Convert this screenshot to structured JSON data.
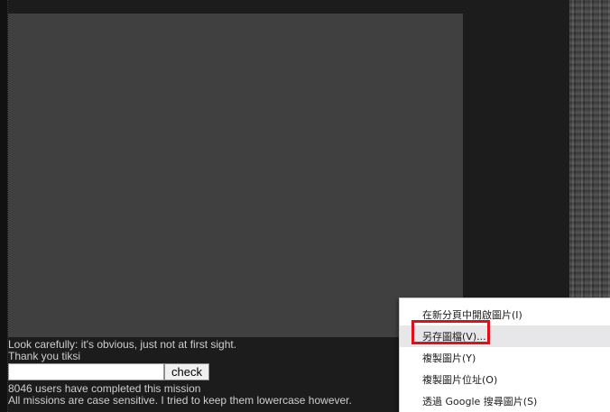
{
  "mission": {
    "hint_line1": "Look carefully: it's obvious, just not at first sight.",
    "hint_line2": "Thank you tiksi",
    "check_label": "check",
    "answer_value": "",
    "completed_text": "8046 users have completed this mission",
    "case_note": "All missions are case sensitive. I tried to keep them lowercase however."
  },
  "context_menu": {
    "items": [
      {
        "label": "在新分頁中開啟圖片(I)"
      },
      {
        "label": "另存圖檔(V)..."
      },
      {
        "label": "複製圖片(Y)"
      },
      {
        "label": "複製圖片位址(O)"
      },
      {
        "label": "透過 Google 搜尋圖片(S)"
      }
    ],
    "highlighted_index": 1
  },
  "colors": {
    "annotation": "#e0101a",
    "canvas": "#404040",
    "background": "#1c1c1c"
  }
}
